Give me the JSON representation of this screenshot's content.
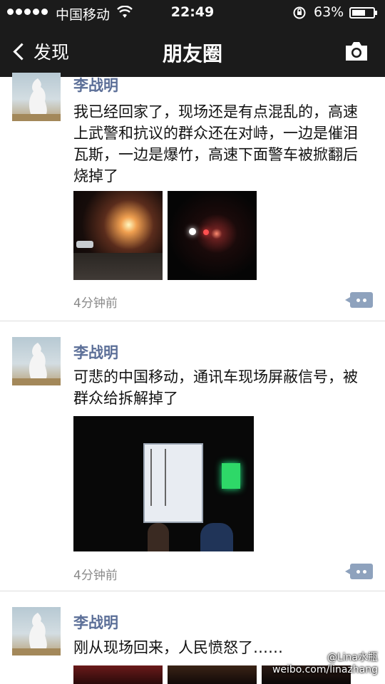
{
  "status_bar": {
    "carrier": "中国移动",
    "time": "22:49",
    "battery_pct": "63%",
    "battery_level": 0.63
  },
  "nav": {
    "back_label": "发现",
    "title": "朋友圈"
  },
  "posts": [
    {
      "author": "李战明",
      "text": "我已经回家了，现场还是有点混乱的，高速上武警和抗议的群众还在对峙，一边是催泪瓦斯，一边是爆竹，高速下面警车被掀翻后烧掉了",
      "time": "4分钟前"
    },
    {
      "author": "李战明",
      "text": "可悲的中国移动，通讯车现场屏蔽信号，被群众给拆解掉了",
      "time": "4分钟前"
    },
    {
      "author": "李战明",
      "text": "刚从现场回来，人民愤怒了……"
    }
  ],
  "watermark": {
    "line1": "@Lina水瓶",
    "line2": "weibo.com/linazhang"
  },
  "colors": {
    "bar_bg": "#1b1b1b",
    "author_name": "#5c6f98",
    "comment_button": "#8ea2bd"
  }
}
